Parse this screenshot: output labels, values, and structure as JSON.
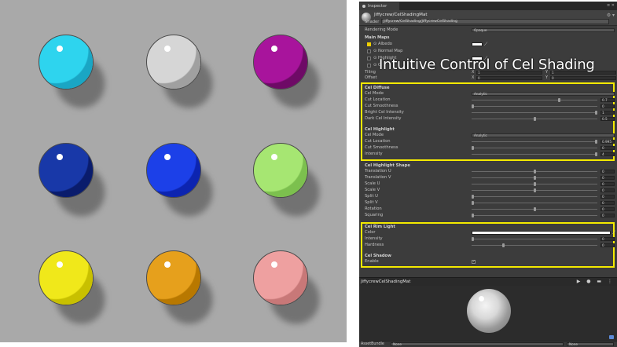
{
  "overlay": {
    "title": "Intuitive Control of Cel Shading"
  },
  "viewport": {
    "balls": [
      {
        "color": "#2ed4ee",
        "dark": "#1aa6c4"
      },
      {
        "color": "#d6d6d6",
        "dark": "#a0a0a0"
      },
      {
        "color": "#a8149c",
        "dark": "#6e0a66"
      },
      {
        "color": "#1838a8",
        "dark": "#0a1c6c"
      },
      {
        "color": "#1c40e8",
        "dark": "#0c24b0"
      },
      {
        "color": "#a6e672",
        "dark": "#7cc04e"
      },
      {
        "color": "#f0e81a",
        "dark": "#c8c000"
      },
      {
        "color": "#e6a01c",
        "dark": "#b87800"
      },
      {
        "color": "#eea0a0",
        "dark": "#c87878"
      }
    ]
  },
  "inspector": {
    "tab_label": "Inspector",
    "tab_controls": "≡ ✕",
    "material_name": "Jiffycrew/CelShadingMat",
    "shader_label": "Shader",
    "shader_value": "Jiffycrew/CelShading/JiffycrewCelShading",
    "header_icons": "⚙ ▾",
    "rendering_mode_label": "Rendering Mode",
    "rendering_mode_value": "Opaque",
    "main_maps_label": "Main Maps",
    "albedo_label": "Albedo",
    "normal_map_label": "Normal Map",
    "highlight_label": "Highlight",
    "c_label": "C",
    "tiling_label": "Tiling",
    "offset_label": "Offset",
    "tiling_x": "1",
    "tiling_y": "1",
    "offset_x": "0",
    "offset_y": "0",
    "x_label": "X",
    "y_label": "Y",
    "cel_diffuse": {
      "title": "Cel Diffuse",
      "mode_label": "Cel Mode",
      "mode_value": "Analytic",
      "rows": [
        {
          "label": "Cut Location",
          "value": "0.7",
          "pos": 0.7
        },
        {
          "label": "Cut Smoothness",
          "value": "0",
          "pos": 0.0
        },
        {
          "label": "Bright Cel Intensity",
          "value": "1",
          "pos": 1.0
        },
        {
          "label": "Dark Cel Intensity",
          "value": "0.5",
          "pos": 0.5
        }
      ]
    },
    "cel_highlight": {
      "title": "Cel Highlight",
      "mode_label": "Cel Mode",
      "mode_value": "Analytic",
      "rows": [
        {
          "label": "Cut Location",
          "value": "0.995",
          "pos": 1.0
        },
        {
          "label": "Cut Smoothness",
          "value": "0",
          "pos": 0.0
        },
        {
          "label": "Intensity",
          "value": "4",
          "pos": 1.0
        }
      ]
    },
    "cel_highlight_shape": {
      "title": "Cel Highlight Shape",
      "rows": [
        {
          "label": "Translation U",
          "value": "0",
          "pos": 0.5
        },
        {
          "label": "Translation V",
          "value": "0",
          "pos": 0.5
        },
        {
          "label": "Scale U",
          "value": "0",
          "pos": 0.5
        },
        {
          "label": "Scale V",
          "value": "0",
          "pos": 0.5
        },
        {
          "label": "Split U",
          "value": "0",
          "pos": 0.0
        },
        {
          "label": "Split V",
          "value": "0",
          "pos": 0.0
        },
        {
          "label": "Rotation",
          "value": "0",
          "pos": 0.5
        },
        {
          "label": "Squaring",
          "value": "0",
          "pos": 0.0
        }
      ]
    },
    "cel_rim_light": {
      "title": "Cel Rim Light",
      "color_label": "Color",
      "rows": [
        {
          "label": "Intensity",
          "value": "0",
          "pos": 0.0
        },
        {
          "label": "Hardness",
          "value": "0",
          "pos": 0.25
        }
      ]
    },
    "cel_shadow": {
      "title": "Cel Shadow",
      "enable_label": "Enable",
      "enable_checked": "✓"
    }
  },
  "preview": {
    "title": "JiffycrewCelShadingMat",
    "controls": "▶ ● ▬ ⋮"
  },
  "asset_bar": {
    "label": "AssetBundle",
    "value1": "None",
    "value2": "None"
  }
}
